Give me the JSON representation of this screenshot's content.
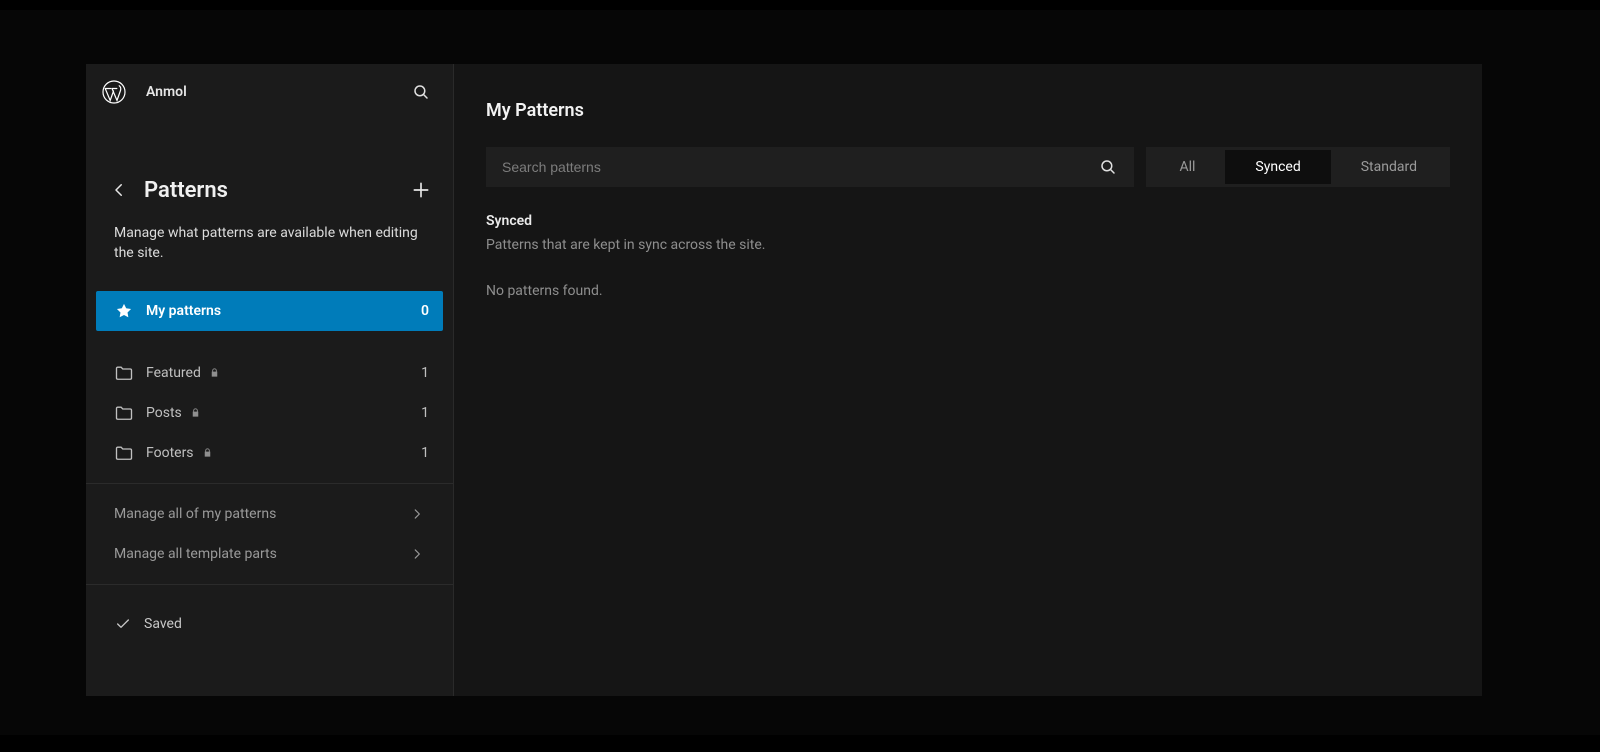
{
  "site_name": "Anmol",
  "sidebar": {
    "title": "Patterns",
    "subtitle": "Manage what patterns are available when editing the site.",
    "nav": {
      "my_patterns": {
        "label": "My patterns",
        "count": "0"
      },
      "categories": [
        {
          "label": "Featured",
          "count": "1",
          "locked": true
        },
        {
          "label": "Posts",
          "count": "1",
          "locked": true
        },
        {
          "label": "Footers",
          "count": "1",
          "locked": true
        }
      ]
    },
    "manage": {
      "all_patterns": "Manage all of my patterns",
      "template_parts": "Manage all template parts"
    },
    "footer": {
      "saved": "Saved"
    }
  },
  "main": {
    "title": "My Patterns",
    "search_placeholder": "Search patterns",
    "filters": {
      "all": "All",
      "synced": "Synced",
      "standard": "Standard"
    },
    "section": {
      "heading": "Synced",
      "description": "Patterns that are kept in sync across the site.",
      "empty": "No patterns found."
    }
  }
}
